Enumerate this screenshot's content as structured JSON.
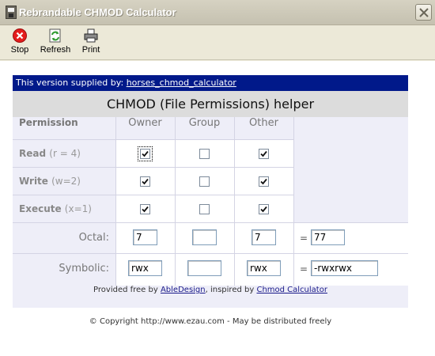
{
  "window": {
    "title": "Rebrandable CHMOD Calculator"
  },
  "toolbar": {
    "stop_label": "Stop",
    "refresh_label": "Refresh",
    "print_label": "Print"
  },
  "banner": {
    "prefix": "This version supplied by:",
    "link": "horses_chmod_calculator"
  },
  "heading": "CHMOD (File Permissions) helper",
  "columns": {
    "permission": "Permission",
    "owner": "Owner",
    "group": "Group",
    "other": "Other"
  },
  "rows": {
    "read": {
      "label": "Read",
      "note": "(r = 4)"
    },
    "write": {
      "label": "Write",
      "note": "(w=2)"
    },
    "execute": {
      "label": "Execute",
      "note": "(x=1)"
    }
  },
  "permissions": {
    "read": {
      "owner": true,
      "group": false,
      "other": true
    },
    "write": {
      "owner": true,
      "group": false,
      "other": true
    },
    "execute": {
      "owner": true,
      "group": false,
      "other": true
    }
  },
  "octal": {
    "label": "Octal:",
    "owner": "7",
    "group": "",
    "other": "7",
    "equals": "=",
    "result": "77"
  },
  "symbolic": {
    "label": "Symbolic:",
    "owner": "rwx",
    "group": "",
    "other": "rwx",
    "equals": "=",
    "result": "-rwxrwx"
  },
  "footer": {
    "provided_prefix": "Provided free by",
    "abledesign": "AbleDesign",
    "inspired": ", inspired by",
    "chmod_calc": "Chmod Calculator",
    "copyright": "© Copyright http://www.ezau.com - May be distributed freely"
  },
  "colors": {
    "banner_bg": "#01198a",
    "grid_bg": "#eeeef8",
    "stop_red": "#e41c1c",
    "refresh_green": "#2e9a2e"
  }
}
